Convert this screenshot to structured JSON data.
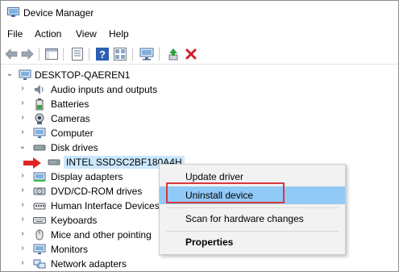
{
  "window": {
    "title": "Device Manager",
    "title_icon": "device-manager-icon"
  },
  "menu": [
    "File",
    "Action",
    "View",
    "Help"
  ],
  "toolbar": {
    "buttons": [
      "back-arrow-icon",
      "forward-arrow-icon",
      "show-hide-tree-icon",
      "properties-icon",
      "help-icon",
      "view-icon",
      "scan-hardware-icon",
      "update-driver-icon",
      "uninstall-icon"
    ]
  },
  "tree": {
    "root": "DESKTOP-QAEREN1",
    "items": [
      {
        "label": "Audio inputs and outputs",
        "icon": "speaker-icon",
        "expanded": false
      },
      {
        "label": "Batteries",
        "icon": "battery-icon",
        "expanded": false
      },
      {
        "label": "Cameras",
        "icon": "camera-icon",
        "expanded": false
      },
      {
        "label": "Computer",
        "icon": "computer-icon",
        "expanded": false
      },
      {
        "label": "Disk drives",
        "icon": "disk-drive-icon",
        "expanded": true
      },
      {
        "label": "INTEL SSDSC2BF180A4H",
        "icon": "disk-drive-icon",
        "child": true,
        "selected": true
      },
      {
        "label": "Display adapters",
        "icon": "display-adapter-icon",
        "expanded": false
      },
      {
        "label": "DVD/CD-ROM drives",
        "icon": "dvd-icon",
        "expanded": false
      },
      {
        "label": "Human Interface Devices",
        "icon": "hid-icon",
        "expanded": false
      },
      {
        "label": "Keyboards",
        "icon": "keyboard-icon",
        "expanded": false
      },
      {
        "label": "Mice and other pointing",
        "icon": "mouse-icon",
        "expanded": false
      },
      {
        "label": "Monitors",
        "icon": "monitor-icon",
        "expanded": false
      },
      {
        "label": "Network adapters",
        "icon": "network-adapter-icon",
        "expanded": false
      }
    ]
  },
  "context_menu": {
    "items": [
      {
        "label": "Update driver"
      },
      {
        "label": "Uninstall device",
        "highlighted": true
      },
      {
        "label": "Scan for hardware changes"
      },
      {
        "label": "Properties",
        "bold": true
      }
    ]
  },
  "colors": {
    "selection": "#cce8ff",
    "menu_highlight": "#91c9f7",
    "annotation_red": "#d6393e"
  }
}
